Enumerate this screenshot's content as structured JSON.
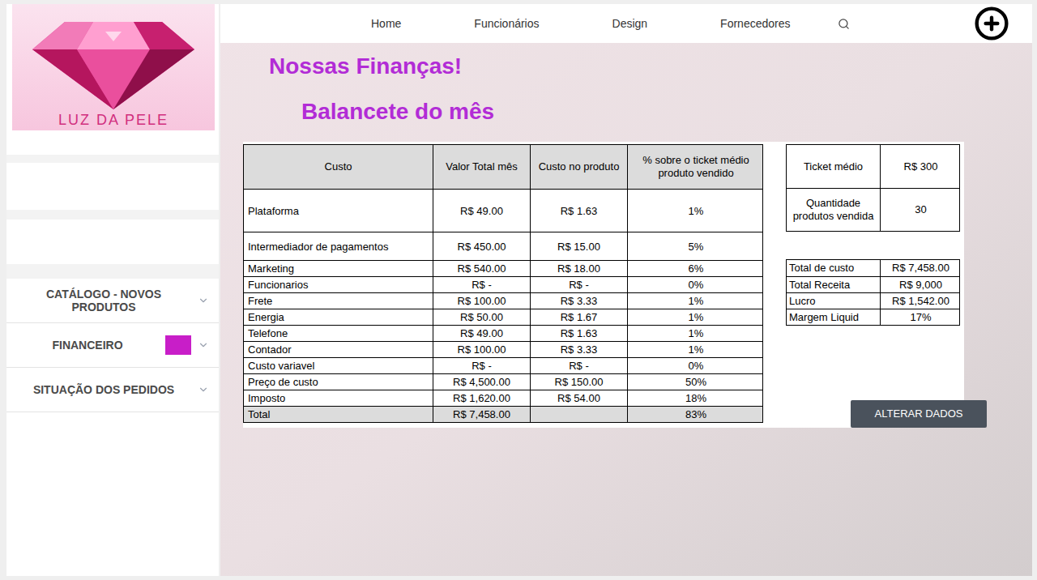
{
  "logo": {
    "text": "LUZ DA PELE"
  },
  "nav": {
    "items": [
      "Home",
      "Funcionários",
      "Design",
      "Fornecedores"
    ]
  },
  "sidebar": {
    "items": [
      {
        "label": "CATÁLOGO - NOVOS PRODUTOS",
        "selected": false
      },
      {
        "label": "FINANCEIRO",
        "selected": true
      },
      {
        "label": "SITUAÇÃO DOS PEDIDOS",
        "selected": false
      }
    ]
  },
  "page": {
    "title": "Nossas Finanças!",
    "subtitle": "Balancete do mês"
  },
  "table": {
    "columns": [
      "Custo",
      "Valor Total mês",
      "Custo no produto",
      "% sobre o ticket médio produto vendido"
    ],
    "rows": [
      [
        "Plataforma",
        "R$ 49.00",
        "R$ 1.63",
        "1%"
      ],
      [
        "Intermediador de pagamentos",
        "R$ 450.00",
        "R$ 15.00",
        "5%"
      ],
      [
        "Marketing",
        "R$ 540.00",
        "R$ 18.00",
        "6%"
      ],
      [
        "Funcionarios",
        "R$ -",
        "R$ -",
        "0%"
      ],
      [
        "Frete",
        "R$ 100.00",
        "R$ 3.33",
        "1%"
      ],
      [
        "Energia",
        "R$ 50.00",
        "R$ 1.67",
        "1%"
      ],
      [
        "Telefone",
        "R$ 49.00",
        "R$ 1.63",
        "1%"
      ],
      [
        "Contador",
        "R$ 100.00",
        "R$ 3.33",
        "1%"
      ],
      [
        "Custo variavel",
        "R$ -",
        "R$ -",
        "0%"
      ],
      [
        "Preço de custo",
        "R$ 4,500.00",
        "R$ 150.00",
        "50%"
      ],
      [
        "Imposto",
        "R$ 1,620.00",
        "R$ 54.00",
        "18%"
      ]
    ],
    "total": [
      "Total",
      "R$ 7,458.00",
      "",
      "83%"
    ]
  },
  "summary": {
    "ticket": [
      {
        "label": "Ticket médio",
        "value": "R$ 300"
      },
      {
        "label": "Quantidade produtos vendida",
        "value": "30"
      }
    ],
    "results": [
      {
        "label": "Total de custo",
        "value": "R$ 7,458.00"
      },
      {
        "label": "Total Receita",
        "value": "R$ 9,000"
      },
      {
        "label": "Lucro",
        "value": "R$ 1,542.00"
      },
      {
        "label": "Margem Liquid",
        "value": "17%"
      }
    ]
  },
  "button": "ALTERAR DADOS"
}
